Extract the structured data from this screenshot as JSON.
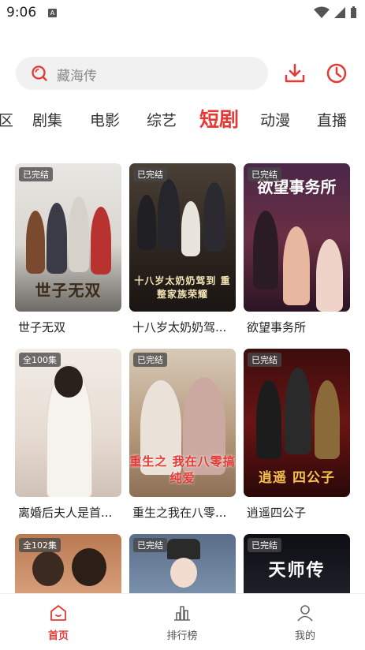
{
  "status_bar": {
    "time": "9:06",
    "notif": "A"
  },
  "search": {
    "placeholder": "藏海传"
  },
  "tabs": [
    {
      "label": "区"
    },
    {
      "label": "剧集"
    },
    {
      "label": "电影"
    },
    {
      "label": "综艺"
    },
    {
      "label": "短剧",
      "active": true
    },
    {
      "label": "动漫"
    },
    {
      "label": "直播"
    }
  ],
  "shows": [
    {
      "title": "世子无双",
      "badge": "已完结",
      "art": "世子无双"
    },
    {
      "title": "十八岁太奶奶驾...",
      "badge": "已完结",
      "art": "十八岁太奶奶驾到 重整家族荣耀"
    },
    {
      "title": "欲望事务所",
      "badge": "已完结",
      "art": "欲望事务所"
    },
    {
      "title": "离婚后夫人是首...",
      "badge": "全100集",
      "art": ""
    },
    {
      "title": "重生之我在八零...",
      "badge": "已完结",
      "art": "重生之 我在八零搞纯爱"
    },
    {
      "title": "逍遥四公子",
      "badge": "已完结",
      "art": "逍遥 四公子"
    },
    {
      "title": "",
      "badge": "全102集",
      "art": ""
    },
    {
      "title": "",
      "badge": "已完结",
      "art": ""
    },
    {
      "title": "",
      "badge": "已完结",
      "art": "天师传"
    }
  ],
  "bottom_nav": [
    {
      "label": "首页",
      "icon": "home-icon",
      "active": true
    },
    {
      "label": "排行榜",
      "icon": "ranking-icon"
    },
    {
      "label": "我的",
      "icon": "profile-icon"
    }
  ],
  "colors": {
    "accent": "#e53935"
  }
}
